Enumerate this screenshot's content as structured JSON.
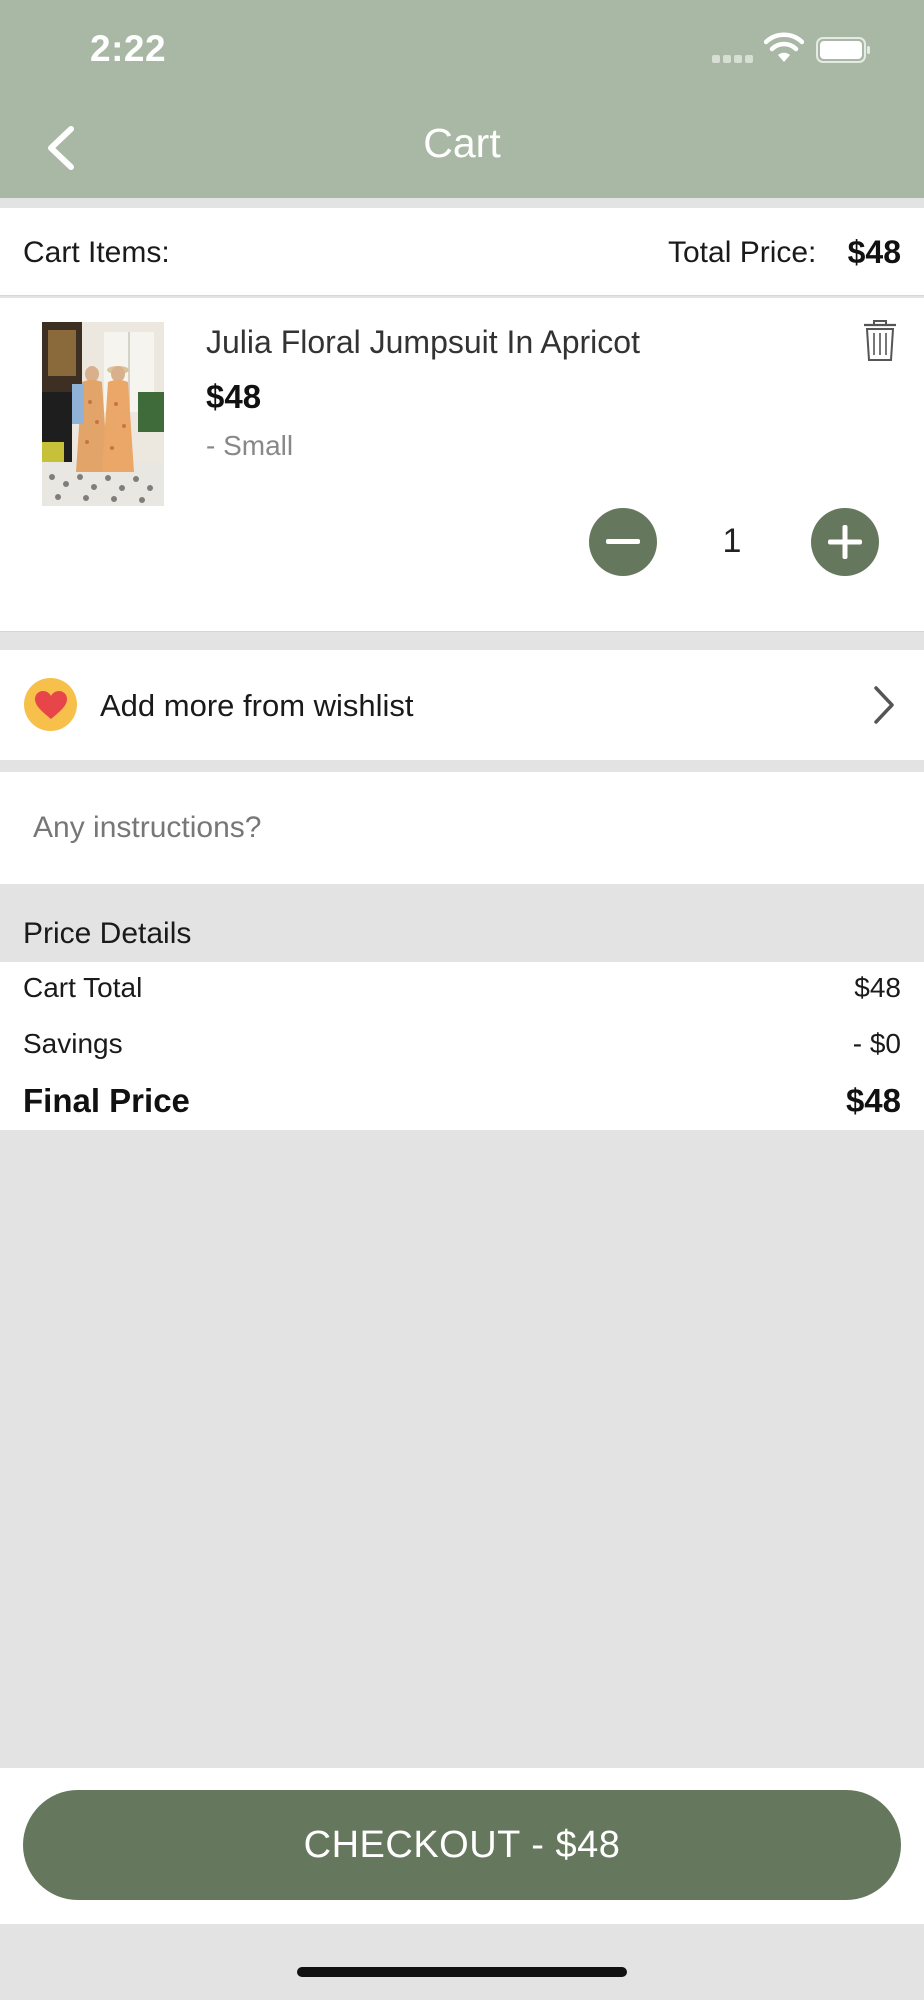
{
  "status_bar": {
    "time": "2:22"
  },
  "header": {
    "title": "Cart"
  },
  "cart_summary": {
    "items_label": "Cart Items:",
    "total_label": "Total Price:",
    "total_value": "$48"
  },
  "item": {
    "name": "Julia Floral Jumpsuit In Apricot",
    "price": "$48",
    "size": "- Small",
    "quantity": "1"
  },
  "wishlist": {
    "label": "Add more from wishlist"
  },
  "instructions": {
    "placeholder": "Any instructions?"
  },
  "price_details": {
    "title": "Price Details",
    "rows": [
      {
        "label": "Cart Total",
        "value": "$48"
      },
      {
        "label": "Savings",
        "value": "- $0"
      },
      {
        "label": "Final Price",
        "value": "$48"
      }
    ]
  },
  "checkout": {
    "label": "CHECKOUT - $48"
  },
  "colors": {
    "header": "#a9b8a5",
    "accent": "#65775c",
    "heart_badge": "#f6c04a",
    "heart": "#e8454a"
  },
  "icons": [
    "back-icon",
    "trash-icon",
    "minus-icon",
    "plus-icon",
    "heart-icon",
    "chevron-right-icon",
    "wifi-icon",
    "battery-icon"
  ]
}
